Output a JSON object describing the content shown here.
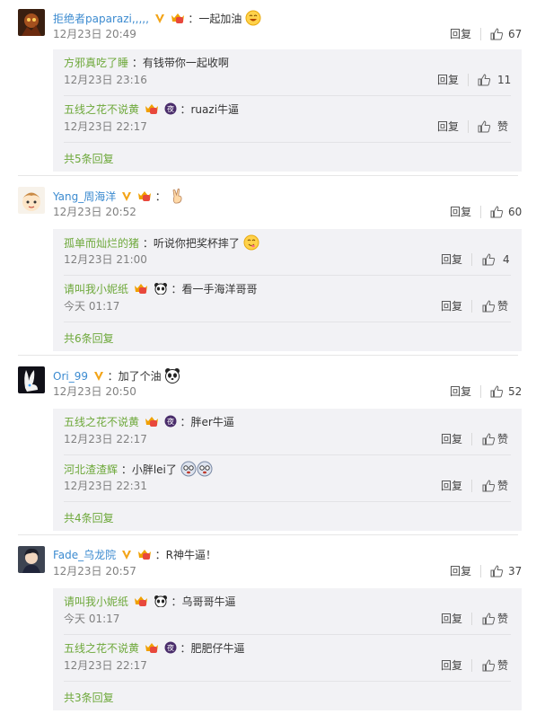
{
  "labels": {
    "reply": "回复",
    "like_zan": "赞"
  },
  "comments": [
    {
      "user": "拒绝者paparazi,,,,,",
      "text": "：一起加油",
      "time": "12月23日 20:49",
      "likes": "67",
      "replies": [
        {
          "user": "方邪真吃了睡",
          "text": "：有钱带你一起收啊",
          "time": "12月23日 23:16",
          "likes": "11"
        },
        {
          "user": "五线之花不说黄",
          "text": "：ruazi牛逼",
          "time": "12月23日 22:17",
          "likes": "赞"
        }
      ],
      "more": "共5条回复"
    },
    {
      "user": "Yang_周海洋",
      "text": "：",
      "time": "12月23日 20:52",
      "likes": "60",
      "replies": [
        {
          "user": "孤单而灿烂的猪",
          "text": "：听说你把奖杯摔了",
          "time": "12月23日 21:00",
          "likes": "4"
        },
        {
          "user": "请叫我小妮纸",
          "text": "：看一手海洋哥哥",
          "time": "今天 01:17",
          "likes": "赞"
        }
      ],
      "more": "共6条回复"
    },
    {
      "user": "Ori_99",
      "text": "：加了个油",
      "time": "12月23日 20:50",
      "likes": "52",
      "replies": [
        {
          "user": "五线之花不说黄",
          "text": "：胖er牛逼",
          "time": "12月23日 22:17",
          "likes": "赞"
        },
        {
          "user": "河北渣渣辉",
          "text": "：小胖lei了",
          "time": "12月23日 22:31",
          "likes": "赞"
        }
      ],
      "more": "共4条回复"
    },
    {
      "user": "Fade_乌龙院",
      "text": "：R神牛逼！",
      "time": "12月23日 20:57",
      "likes": "37",
      "replies": [
        {
          "user": "请叫我小妮纸",
          "text": "：乌哥哥牛逼",
          "time": "今天 01:17",
          "likes": "赞"
        },
        {
          "user": "五线之花不说黄",
          "text": "：肥肥仔牛逼",
          "time": "12月23日 22:17",
          "likes": "赞"
        }
      ],
      "more": "共3条回复"
    }
  ],
  "badge_text": {
    "vip": "V",
    "night": "夜"
  },
  "colors": {
    "link": "#3c8bd0",
    "reply_user": "#6da83a",
    "vip": "#f3a417",
    "panel": "#f2f2f5"
  }
}
